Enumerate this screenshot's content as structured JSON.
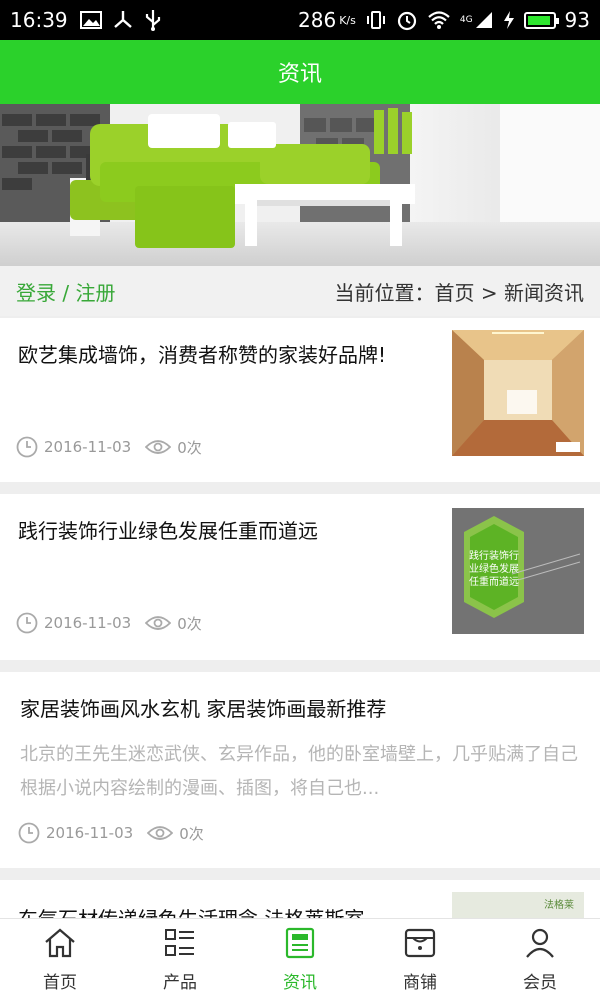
{
  "status_bar": {
    "time": "16:39",
    "network_speed": "286",
    "network_unit": "K/s",
    "signal_label": "4G",
    "battery_level": "93",
    "battery_fraction": 0.93,
    "battery_color": "#2ee62e",
    "left_icons": [
      "image-icon",
      "share-icon",
      "usb-icon"
    ],
    "right_icons": [
      "vibrate-icon",
      "alarm-icon",
      "wifi-icon",
      "signal-icon",
      "charging-icon",
      "battery-icon"
    ]
  },
  "header": {
    "title": "资讯",
    "color": "#2bd12b"
  },
  "locbar": {
    "login_link": "登录 / 注册",
    "location_text": "当前位置：首页 > 新闻资讯"
  },
  "news": [
    {
      "title": "欧艺集成墙饰，消费者称赞的家装好品牌!",
      "date": "2016-11-03",
      "views": "0次"
    },
    {
      "title": "践行装饰行业绿色发展任重而道远",
      "date": "2016-11-03",
      "views": "0次",
      "thumb_lines": [
        "践行装饰行",
        "业绿色发展",
        "任重而道远"
      ]
    },
    {
      "title": "家居装饰画风水玄机 家居装饰画最新推荐",
      "summary": "北京的王先生迷恋武侠、玄异作品，他的卧室墙壁上，几乎贴满了自己根据小说内容绘制的漫画、插图，将自己也...",
      "date": "2016-11-03",
      "views": "0次"
    },
    {
      "title": "东气石材传递绿色生活理念 法格莱斯室",
      "thumb_brand": "法格莱"
    }
  ],
  "bottom_nav": [
    {
      "label": "首页",
      "icon": "home-icon",
      "active": false
    },
    {
      "label": "产品",
      "icon": "list-icon",
      "active": false
    },
    {
      "label": "资讯",
      "icon": "news-icon",
      "active": true
    },
    {
      "label": "商铺",
      "icon": "store-icon",
      "active": false
    },
    {
      "label": "会员",
      "icon": "user-icon",
      "active": false
    }
  ],
  "colors": {
    "accent": "#2bd12b",
    "active_nav": "#2bb82b",
    "login": "#38a838"
  }
}
